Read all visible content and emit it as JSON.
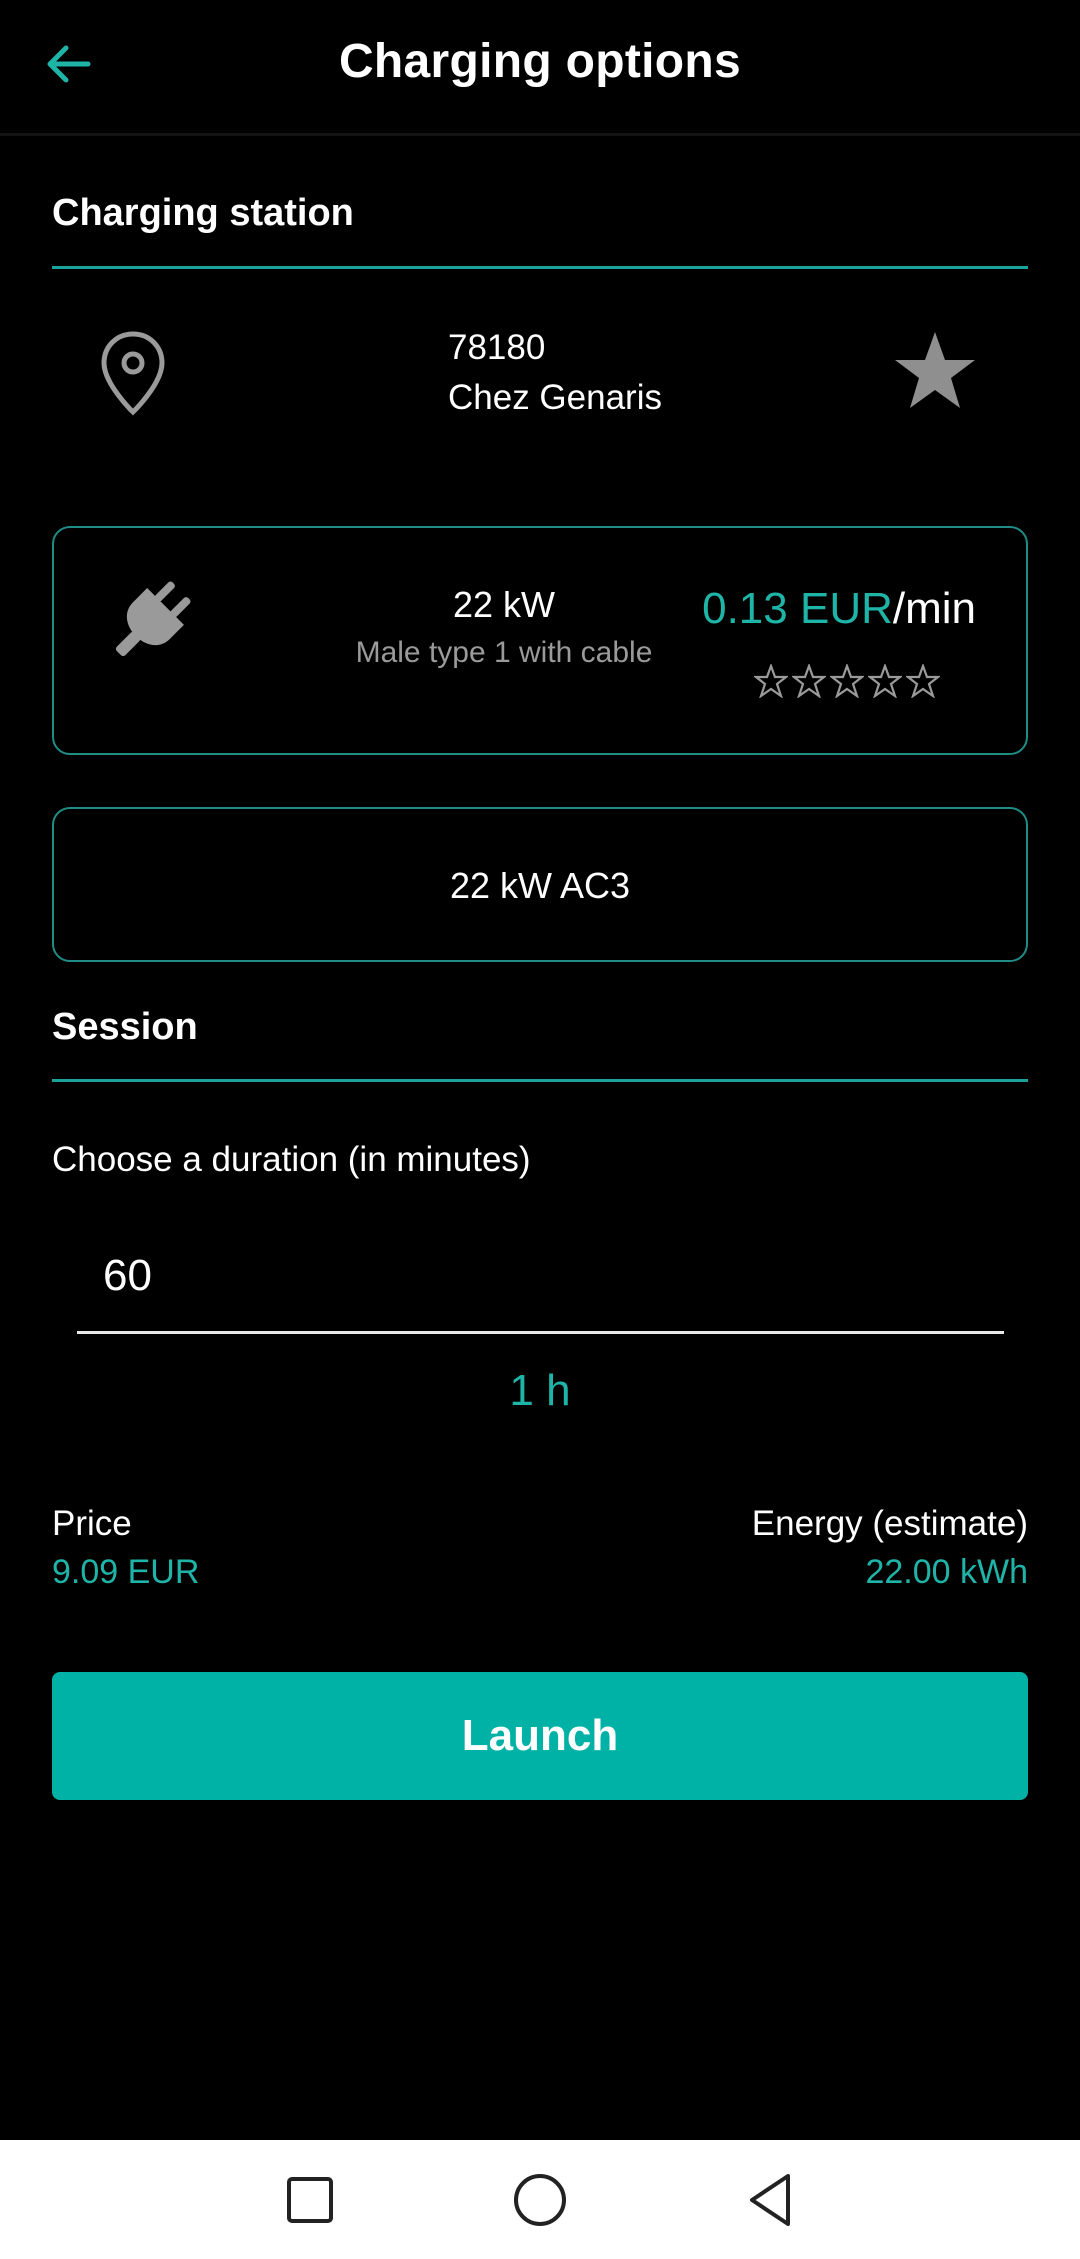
{
  "header": {
    "title": "Charging options",
    "back_icon": "arrow-left-icon",
    "accent_color": "#1fb4a8"
  },
  "station_section": {
    "title": "Charging station",
    "zip": "78180",
    "name": "Chez Genaris",
    "location_icon": "map-pin-icon",
    "favorite_icon": "star-icon"
  },
  "connector": {
    "icon": "plug-icon",
    "power": "22 kW",
    "type": "Male type 1 with cable",
    "price_amount": "0.13 EUR",
    "price_unit": "/min",
    "rating": 0,
    "rating_max": 5
  },
  "option": {
    "label": "22 kW AC3"
  },
  "session_section": {
    "title": "Session",
    "duration_label": "Choose a duration (in minutes)",
    "duration_value": "60",
    "duration_human": "1 h",
    "price_label": "Price",
    "price_value": "9.09 EUR",
    "energy_label": "Energy (estimate)",
    "energy_value": "22.00 kWh",
    "launch_label": "Launch",
    "launch_color": "#00b2a6"
  },
  "navbar": {
    "items": [
      "recent-apps-icon",
      "home-icon",
      "back-triangle-icon"
    ]
  }
}
